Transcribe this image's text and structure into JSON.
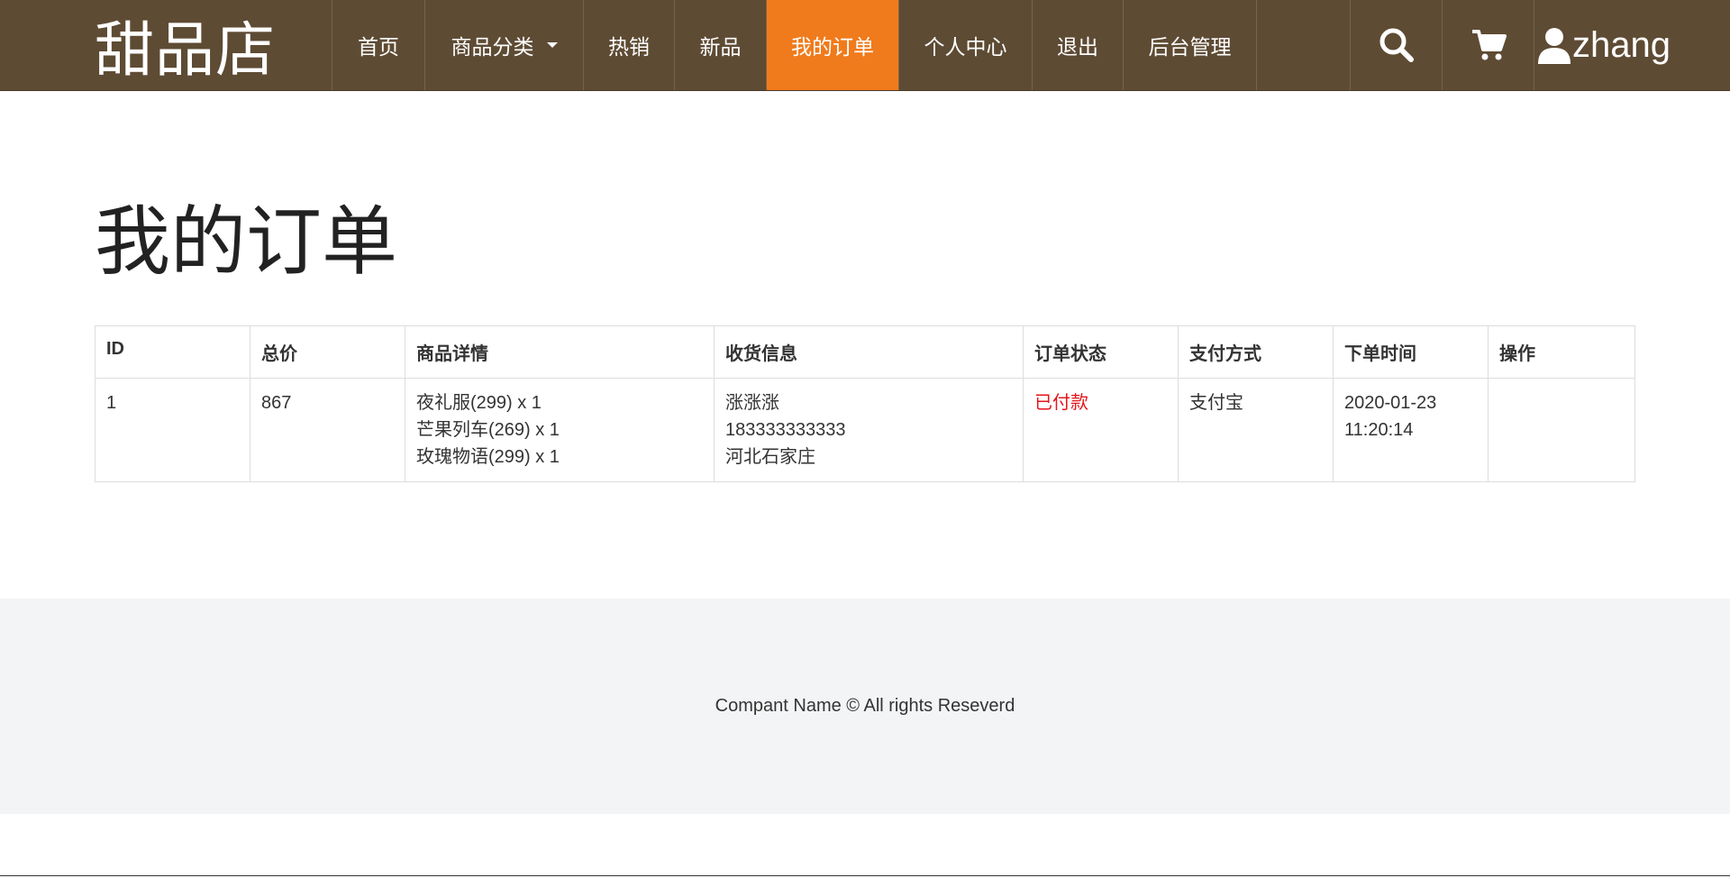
{
  "brand": {
    "name": "甜品店"
  },
  "nav": {
    "items": [
      {
        "label": "首页",
        "active": false
      },
      {
        "label": "商品分类",
        "active": false,
        "dropdown": true
      },
      {
        "label": "热销",
        "active": false
      },
      {
        "label": "新品",
        "active": false
      },
      {
        "label": "我的订单",
        "active": true
      },
      {
        "label": "个人中心",
        "active": false
      },
      {
        "label": "退出",
        "active": false
      },
      {
        "label": "后台管理",
        "active": false
      }
    ],
    "icons": [
      "search-icon",
      "cart-icon",
      "user-icon"
    ],
    "username": "zhang"
  },
  "page": {
    "title": "我的订单"
  },
  "orders": {
    "headers": [
      "ID",
      "总价",
      "商品详情",
      "收货信息",
      "订单状态",
      "支付方式",
      "下单时间",
      "操作"
    ],
    "rows": [
      {
        "id": "1",
        "total": "867",
        "items": [
          "夜礼服(299) x 1",
          "芒果列车(269) x 1",
          "玫瑰物语(299) x 1"
        ],
        "shipping": [
          "涨涨涨",
          "183333333333",
          "河北石家庄"
        ],
        "status": "已付款",
        "payment": "支付宝",
        "time": [
          "2020-01-23",
          "11:20:14"
        ],
        "action": ""
      }
    ]
  },
  "footer": {
    "text": "Compant Name © All rights Reseverd"
  },
  "colors": {
    "nav_bg": "#5e4b34",
    "nav_active": "#f07b1c",
    "status_paid": "#e4161b",
    "footer_bg": "#f2f4f5"
  }
}
